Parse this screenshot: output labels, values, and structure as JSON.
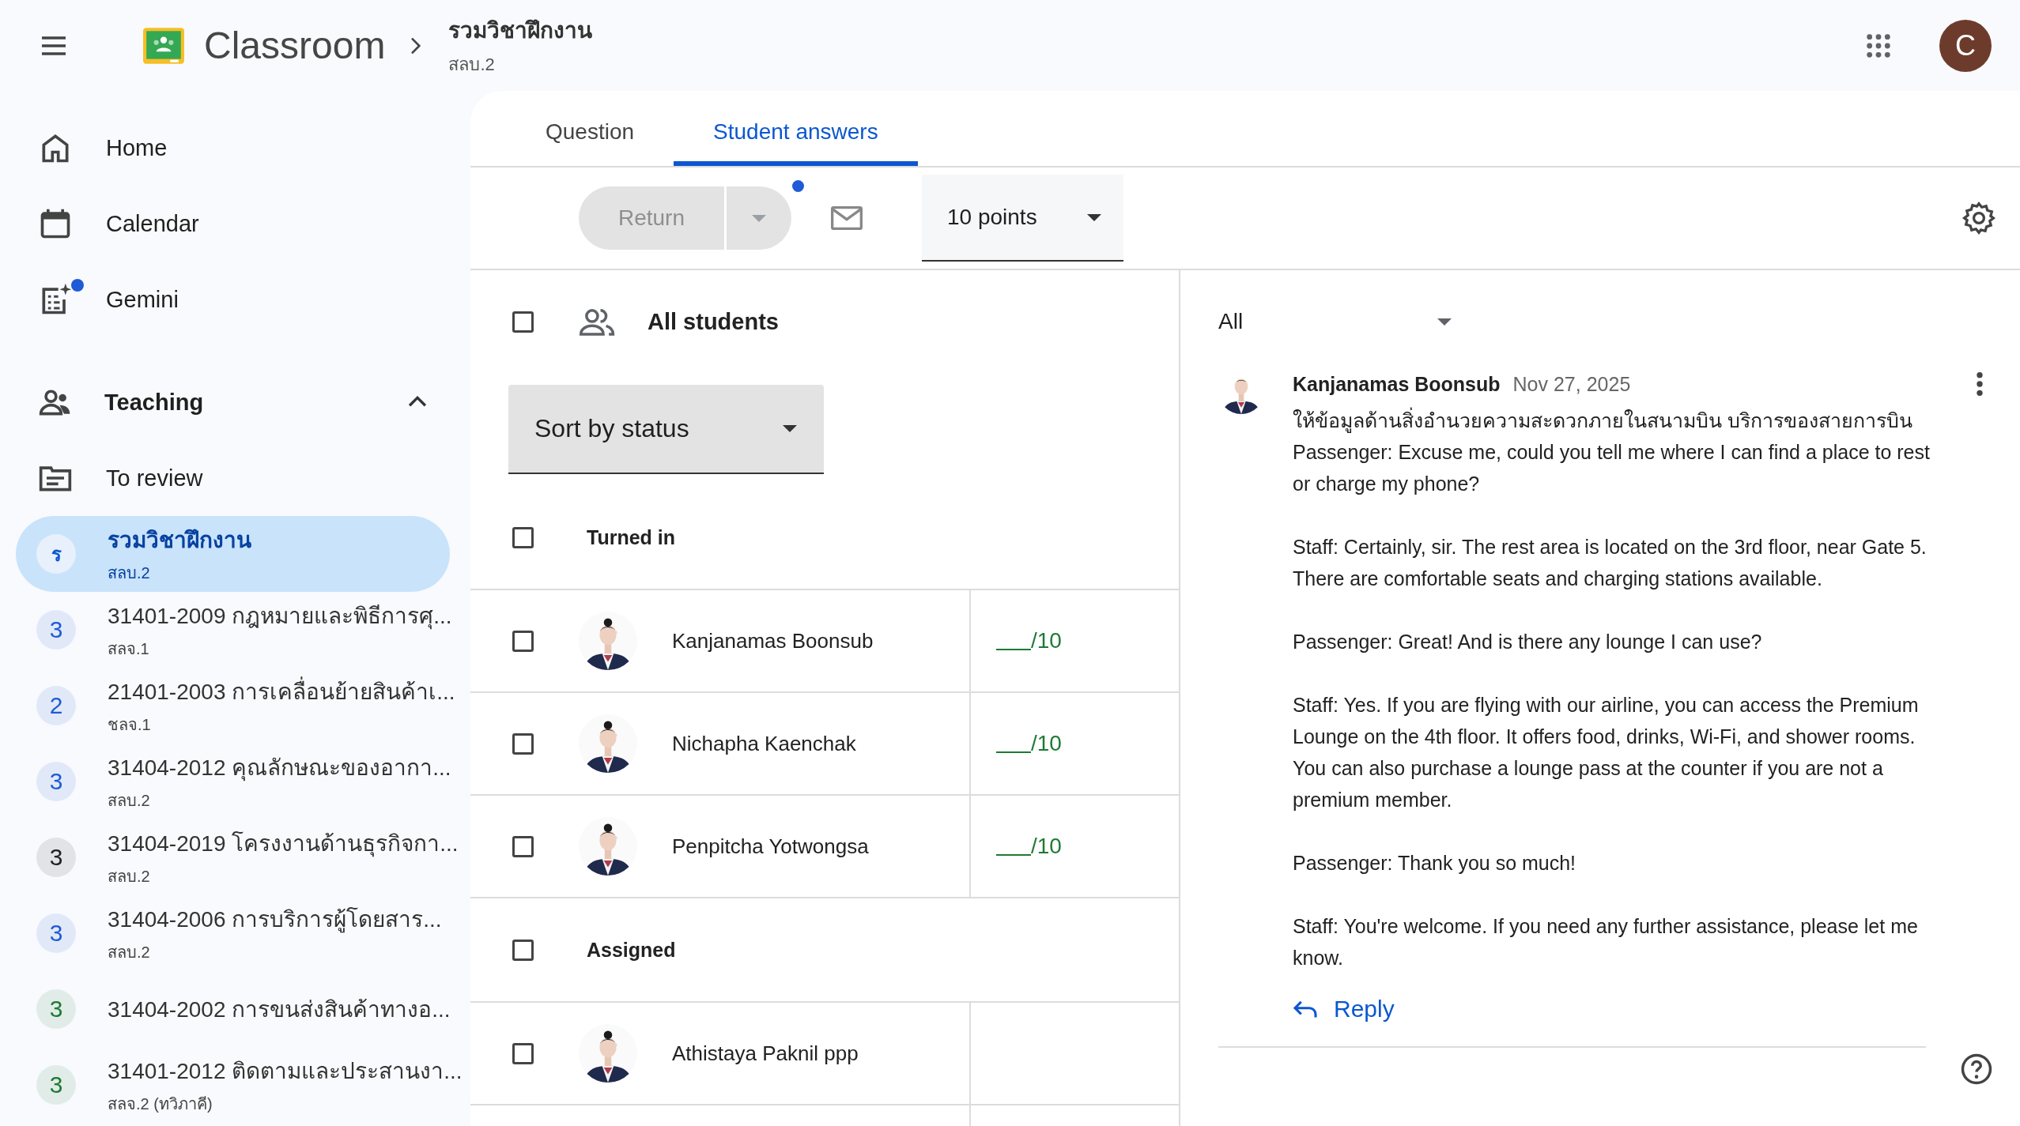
{
  "app_bar": {
    "title": "Classroom",
    "breadcrumb": {
      "title": "รวมวิชาฝึกงาน",
      "subtitle": "สลบ.2"
    },
    "avatar_letter": "C"
  },
  "sidebar": {
    "nav": [
      {
        "kind": "home",
        "label": "Home",
        "notification": false
      },
      {
        "kind": "calendar",
        "label": "Calendar",
        "notification": false
      },
      {
        "kind": "gemini",
        "label": "Gemini",
        "notification": true
      }
    ],
    "teaching": {
      "label": "Teaching",
      "expanded": true
    },
    "to_review": {
      "label": "To review"
    },
    "courses": [
      {
        "badge": "ร",
        "title": "รวมวิชาฝึกงาน",
        "subtitle": "สลบ.2",
        "color": "#0b57d0",
        "selected": true
      },
      {
        "badge": "3",
        "title": "31401-2009 กฎหมายและพิธีการศุ...",
        "subtitle": "สลจ.1",
        "color": "#1f5bd6",
        "selected": false
      },
      {
        "badge": "2",
        "title": "21401-2003 การเคลื่อนย้ายสินค้าเ...",
        "subtitle": "ชลจ.1",
        "color": "#1f5bd6",
        "selected": false
      },
      {
        "badge": "3",
        "title": "31404-2012 คุณลักษณะของอากา...",
        "subtitle": "สลบ.2",
        "color": "#1f5bd6",
        "selected": false
      },
      {
        "badge": "3",
        "title": "31404-2019 โครงงานด้านธุรกิจกา...",
        "subtitle": "สลบ.2",
        "color": "#202124",
        "selected": false
      },
      {
        "badge": "3",
        "title": "31404-2006 การบริการผู้โดยสาร...",
        "subtitle": "สลบ.2",
        "color": "#1f5bd6",
        "selected": false
      },
      {
        "badge": "3",
        "title": "31404-2002 การขนส่งสินค้าทางอ...",
        "color": "#1e7a34",
        "selected": false
      },
      {
        "badge": "3",
        "title": "31401-2012 ติดตามและประสานงา...",
        "subtitle": "สลจ.2 (ทวิภาคี)",
        "color": "#1e7a34",
        "selected": false
      }
    ]
  },
  "tabs": [
    {
      "label": "Question",
      "selected": false
    },
    {
      "label": "Student answers",
      "selected": true
    }
  ],
  "toolbar": {
    "return_button": {
      "label": "Return",
      "disabled": true
    },
    "notification": true,
    "points": "10 points"
  },
  "students": {
    "all": {
      "label": "All students",
      "checked": false
    },
    "sort": "Sort by status",
    "groups": [
      {
        "label": "Turned in",
        "checked": false,
        "students": [
          {
            "name": "Kanjanamas Boonsub",
            "grade": "/10",
            "checked": false
          },
          {
            "name": "Nichapha Kaenchak",
            "grade": "/10",
            "checked": false
          },
          {
            "name": "Penpitcha Yotwongsa",
            "grade": "/10",
            "checked": false
          }
        ]
      },
      {
        "label": "Assigned",
        "checked": false,
        "students": [
          {
            "name": "Athistaya Paknil ppp",
            "checked": false
          }
        ]
      }
    ]
  },
  "answers": {
    "filter": "All",
    "comment": {
      "author": "Kanjanamas Boonsub",
      "date": "Nov 27, 2025",
      "paragraphs": [
        [
          "ให้ข้อมูลด้านสิ่งอำนวยความสะดวกภายในสนามบิน บริการของสายการบิน",
          "Passenger: Excuse me, could you tell me where I can find a place to rest or charge my phone?"
        ],
        [
          "Staff: Certainly, sir. The rest area is located on the 3rd floor, near Gate 5. There are comfortable seats and charging stations available."
        ],
        [
          "Passenger: Great! And is there any lounge I can use?"
        ],
        [
          "Staff: Yes. If you are flying with our airline, you can access the Premium Lounge on the 4th floor. It offers food, drinks, Wi-Fi, and shower rooms. You can also purchase a lounge pass at the counter if you are not a premium member."
        ],
        [
          "Passenger: Thank you so much!"
        ],
        [
          "Staff: You're welcome. If you need any further assistance, please let me know."
        ]
      ],
      "reply": "Reply"
    }
  }
}
